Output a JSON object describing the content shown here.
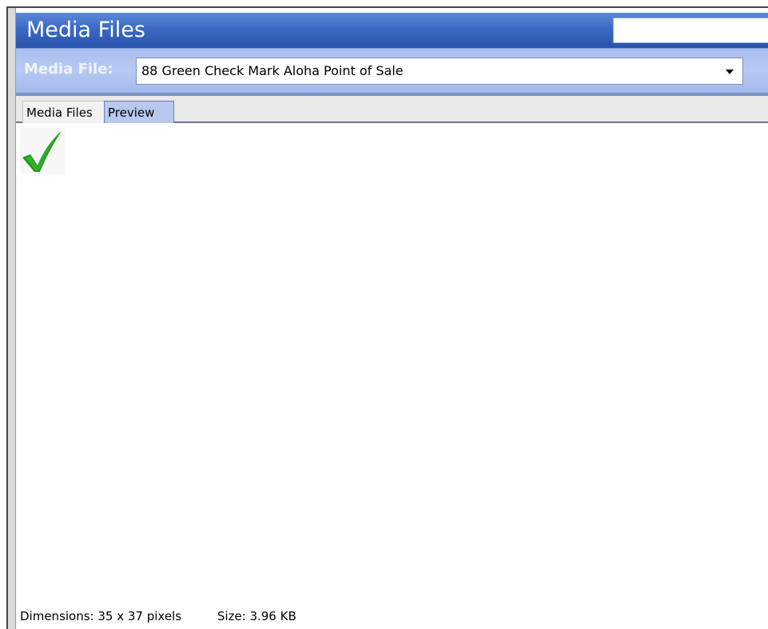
{
  "title_bar": {
    "title": "Media Files",
    "search_value": ""
  },
  "media_file": {
    "label": "Media File:",
    "selected": "88 Green Check Mark Aloha Point of Sale"
  },
  "tabs": [
    {
      "label": "Media Files",
      "active": false
    },
    {
      "label": "Preview",
      "active": true
    }
  ],
  "preview": {
    "image_icon": "green-check-mark-icon",
    "image_color": "#1a9a17"
  },
  "status": {
    "dimensions": "Dimensions: 35 x 37 pixels",
    "size": "Size: 3.96 KB"
  },
  "colors": {
    "title_bar": "#3a69c4",
    "file_bar": "#b3c6f2",
    "active_tab": "#b8c8ee"
  }
}
